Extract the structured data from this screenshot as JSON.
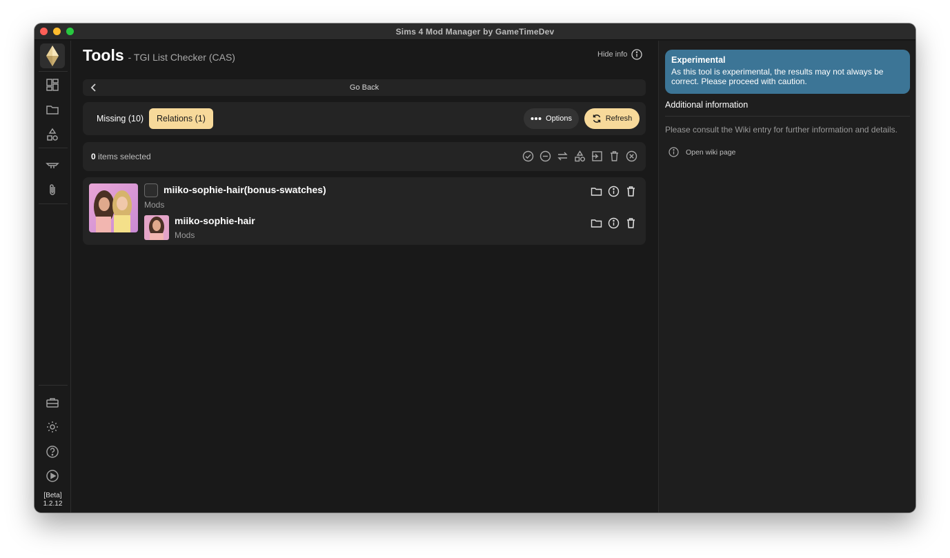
{
  "window": {
    "title": "Sims 4 Mod Manager by GameTimeDev"
  },
  "sidebar": {
    "items": [
      {
        "name": "dashboard-icon"
      },
      {
        "name": "folder-icon"
      },
      {
        "name": "shapes-icon"
      },
      {
        "name": "tray-icon"
      },
      {
        "name": "paperclip-icon"
      }
    ],
    "bottom_items": [
      {
        "name": "toolbox-icon"
      },
      {
        "name": "gear-icon"
      },
      {
        "name": "help-icon"
      },
      {
        "name": "play-icon"
      }
    ],
    "version_label": "[Beta]",
    "version_number": "1.2.12"
  },
  "header": {
    "title": "Tools",
    "subtitle": "- TGI List Checker (CAS)",
    "hide_info_label": "Hide info"
  },
  "goback": {
    "label": "Go Back"
  },
  "tabs": [
    {
      "label": "Missing (10)",
      "active": false
    },
    {
      "label": "Relations (1)",
      "active": true
    }
  ],
  "actions": {
    "options_label": "Options",
    "refresh_label": "Refresh"
  },
  "selection": {
    "count": "0",
    "text": "items selected"
  },
  "items": [
    {
      "name": "miiko-sophie-hair(bonus-swatches)",
      "location": "Mods"
    },
    {
      "name": "miiko-sophie-hair",
      "location": "Mods"
    }
  ],
  "info_panel": {
    "experimental_title": "Experimental",
    "experimental_body": "As this tool is experimental, the results may not always be correct. Please proceed with caution.",
    "additional_title": "Additional information",
    "consult_text": "Please consult the Wiki entry for further information and details.",
    "wiki_link": "Open wiki page"
  },
  "colors": {
    "accent": "#f7d99a",
    "info_box": "#3c7596",
    "background": "#191919",
    "panel": "#242424"
  }
}
